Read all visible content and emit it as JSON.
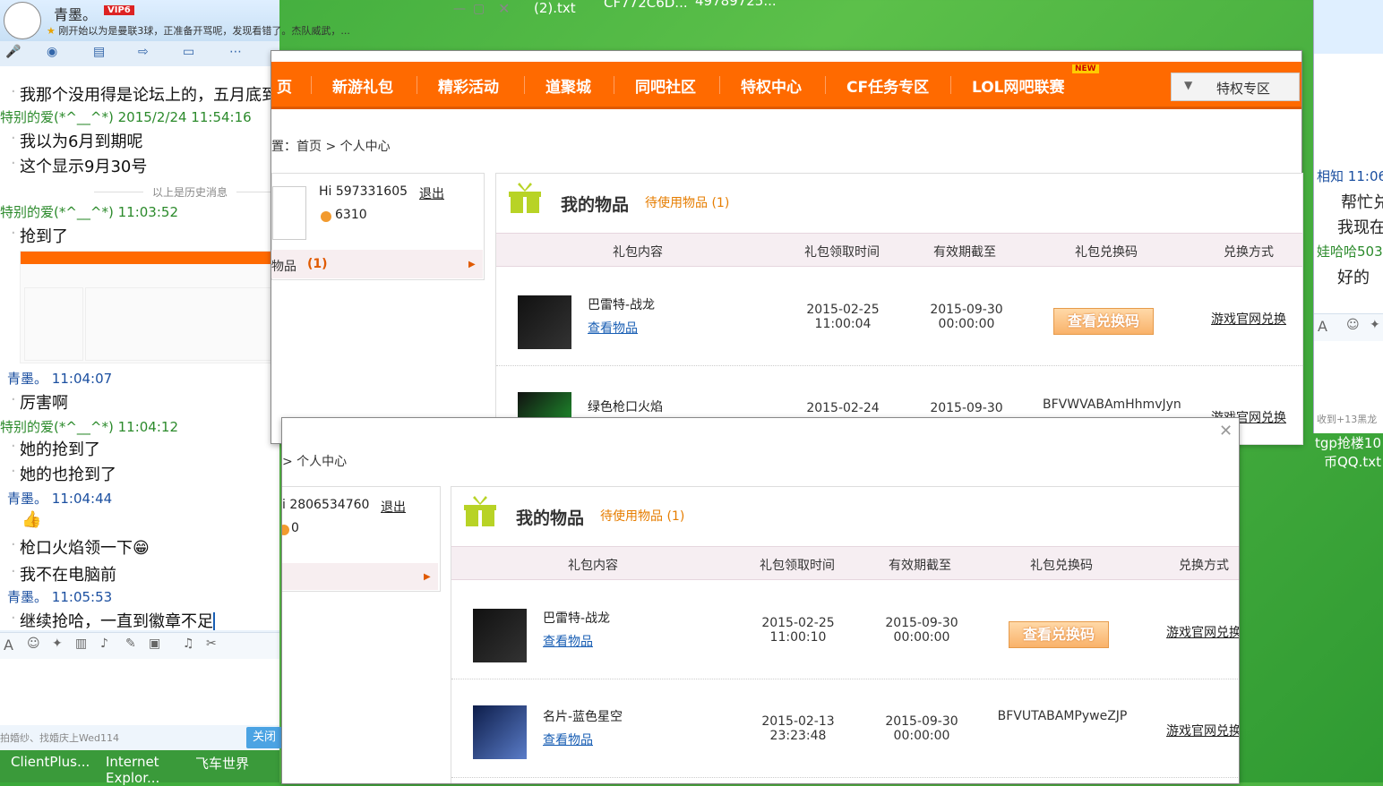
{
  "desktop": {
    "files": [
      "(2).txt",
      "CF772C6D...",
      "49789725..."
    ],
    "right_file": [
      "tgp抢楼10",
      "币QQ.txt"
    ]
  },
  "chat": {
    "contact_name": "青墨。",
    "vip": "VIP6",
    "status": "刚开始以为是曼联3球，正准备开骂呢，发现看错了。杰队威武，...",
    "messages_top_text": "我那个没用得是论坛上的，五月底到期",
    "sender1": "特别的爱(*^__^*)",
    "time1": "2015/2/24 11:54:16",
    "line1a": "我以为6月到期呢",
    "line1b": "这个显示9月30号",
    "history": "以上是历史消息",
    "time2": "11:03:52",
    "line2": "抢到了",
    "me": "青墨。",
    "time3": "11:04:07",
    "line3": "厉害啊",
    "time4": "11:04:12",
    "line4a": "她的抢到了",
    "line4b": "她的也抢到了",
    "time5": "11:04:44",
    "line5a": "枪口火焰领一下",
    "line5b": "我不在电脑前",
    "time6": "11:05:53",
    "line6": "继续抢哈，一直到徽章不足",
    "footer_ad": "拍婚纱、找婚庆上Wed114",
    "close_label": "关闭",
    "taskbar": [
      "ClientPlus...",
      "Internet Explor...",
      "飞车世界"
    ]
  },
  "rchat": {
    "name1": "相知",
    "time1": "11:06",
    "line1": "帮忙兑",
    "line2": "我现在",
    "name2": "娃哈哈503",
    "line3": "好的",
    "footer": "收到+13黑龙"
  },
  "w1": {
    "nav": [
      "页",
      "新游礼包",
      "精彩活动",
      "道聚城",
      "同吧社区",
      "特权中心",
      "CF任务专区",
      "LOL网吧联赛"
    ],
    "new_badge": "NEW",
    "dropdown": "特权专区",
    "crumb": "置：首页 > 个人中心",
    "user": "Hi 597331605",
    "logout": "退出",
    "points": "6310",
    "sidebar_item": "物品",
    "sidebar_count": "(1)",
    "title": "我的物品",
    "pending": "待使用物品 (1)",
    "headers": [
      "礼包内容",
      "礼包领取时间",
      "有效期截至",
      "礼包兑换码",
      "兑换方式"
    ],
    "rows": [
      {
        "name": "巴雷特-战龙",
        "view": "查看物品",
        "got_date": "2015-02-25",
        "got_time": "11:00:04",
        "exp_date": "2015-09-30",
        "exp_time": "00:00:00",
        "code": "查看兑换码",
        "redeem": "游戏官网兑换"
      },
      {
        "name": "绿色枪口火焰",
        "view": "",
        "got_date": "2015-02-24",
        "got_time": "",
        "exp_date": "2015-09-30",
        "exp_time": "",
        "code": "BFVWVABAmHhmvJyn",
        "redeem": "游戏官网兑换"
      }
    ]
  },
  "w2": {
    "crumb": "> 个人中心",
    "user": "i 2806534760",
    "logout": "退出",
    "points": "0",
    "title": "我的物品",
    "pending": "待使用物品 (1)",
    "headers": [
      "礼包内容",
      "礼包领取时间",
      "有效期截至",
      "礼包兑换码",
      "兑换方式"
    ],
    "rows": [
      {
        "name": "巴雷特-战龙",
        "view": "查看物品",
        "got_date": "2015-02-25",
        "got_time": "11:00:10",
        "exp_date": "2015-09-30",
        "exp_time": "00:00:00",
        "code": "查看兑换码",
        "redeem": "游戏官网兑换"
      },
      {
        "name": "名片-蓝色星空",
        "view": "查看物品",
        "got_date": "2015-02-13",
        "got_time": "23:23:48",
        "exp_date": "2015-09-30",
        "exp_time": "00:00:00",
        "code": "BFVUTABAMPyweZJP",
        "redeem": "游戏官网兑换"
      }
    ]
  }
}
